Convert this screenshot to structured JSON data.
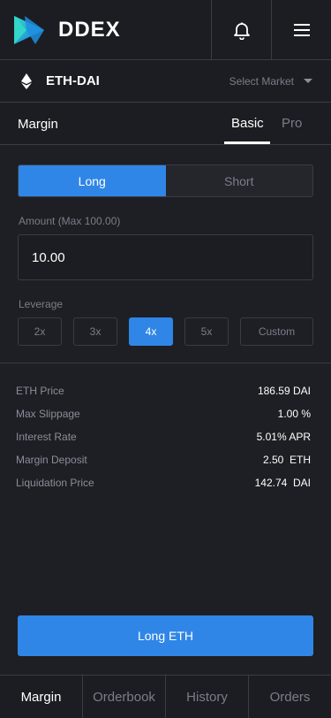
{
  "header": {
    "logo_text": "DDEX",
    "bell_icon": "bell-icon",
    "menu_icon": "hamburger-menu-icon"
  },
  "market": {
    "icon": "ethereum-icon",
    "pair": "ETH-DAI",
    "select_label": "Select Market",
    "caret_icon": "caret-down-icon"
  },
  "mode": {
    "title": "Margin",
    "tabs": [
      {
        "label": "Basic",
        "active": true
      },
      {
        "label": "Pro",
        "active": false
      }
    ]
  },
  "trade": {
    "side_options": [
      {
        "label": "Long",
        "active": true
      },
      {
        "label": "Short",
        "active": false
      }
    ],
    "amount_label": "Amount (Max 100.00)",
    "amount_value": "10.00",
    "leverage_label": "Leverage",
    "leverage_options": [
      {
        "label": "2x",
        "active": false
      },
      {
        "label": "3x",
        "active": false
      },
      {
        "label": "4x",
        "active": true
      },
      {
        "label": "5x",
        "active": false
      },
      {
        "label": "Custom",
        "active": false
      }
    ]
  },
  "info": [
    {
      "label": "ETH Price",
      "value": "186.59 DAI"
    },
    {
      "label": "Max Slippage",
      "value": "1.00 %"
    },
    {
      "label": "Interest Rate",
      "value": "5.01% APR"
    },
    {
      "label": "Margin Deposit",
      "value": "2.50  ETH"
    },
    {
      "label": "Liquidation Price",
      "value": "142.74  DAI"
    }
  ],
  "action_label": "Long ETH",
  "bottom_nav": [
    {
      "label": "Margin",
      "active": true
    },
    {
      "label": "Orderbook",
      "active": false
    },
    {
      "label": "History",
      "active": false
    },
    {
      "label": "Orders",
      "active": false
    }
  ],
  "colors": {
    "background": "#1e1f24",
    "accent": "#2f86e6",
    "border": "#3a3c44",
    "muted_text": "#7a7e89",
    "logo_gradient_start": "#27c7d8",
    "logo_gradient_end": "#1e6fd9"
  }
}
